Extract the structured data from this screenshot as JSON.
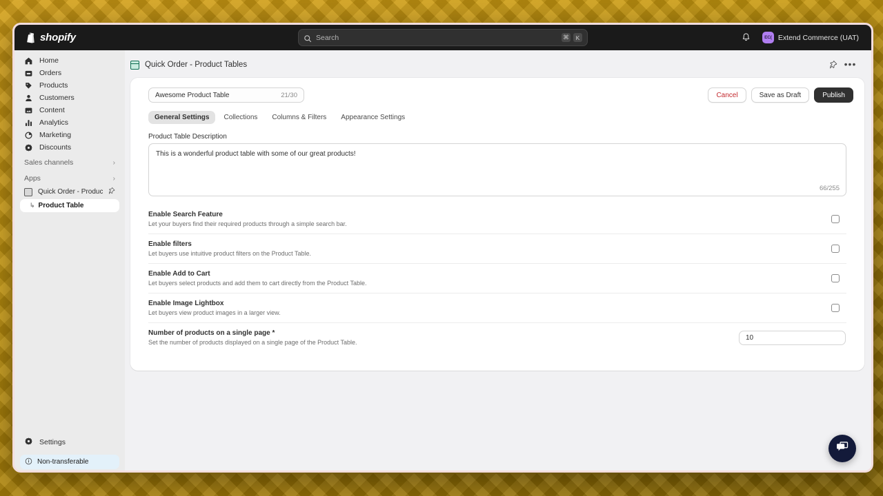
{
  "topbar": {
    "brand": "shopify",
    "brand_icon": "shopify-bag-icon",
    "search": {
      "placeholder": "Search",
      "icon": "search-icon",
      "shortcut_modifier": "⌘",
      "shortcut_key": "K"
    },
    "notifications_icon": "bell-icon",
    "store": {
      "initials": "EC(",
      "name": "Extend Commerce (UAT)",
      "avatar_color": "#b07ef0"
    }
  },
  "sidebar": {
    "items": [
      {
        "label": "Home",
        "icon": "home-icon"
      },
      {
        "label": "Orders",
        "icon": "orders-inbox-icon"
      },
      {
        "label": "Products",
        "icon": "products-tag-icon"
      },
      {
        "label": "Customers",
        "icon": "customers-person-icon"
      },
      {
        "label": "Content",
        "icon": "content-media-icon"
      },
      {
        "label": "Analytics",
        "icon": "analytics-bars-icon"
      },
      {
        "label": "Marketing",
        "icon": "marketing-megaphone-icon"
      },
      {
        "label": "Discounts",
        "icon": "discounts-gear-icon"
      }
    ],
    "groups": [
      {
        "label": "Sales channels",
        "chevron": "›"
      },
      {
        "label": "Apps",
        "chevron": "›"
      }
    ],
    "app": {
      "label": "Quick Order - Product...",
      "icon": "app-table-icon",
      "pin_icon": "pin-icon",
      "sub_item": "Product Table",
      "sub_arrow": "↳"
    },
    "settings": {
      "label": "Settings",
      "icon": "gear-icon"
    },
    "banner": {
      "label": "Non-transferable",
      "icon": "info-circle-icon",
      "bg": "#e3f1fa"
    }
  },
  "page": {
    "icon": "product-table-icon",
    "title": "Quick Order - Product Tables",
    "pin_icon": "pin-icon",
    "more_icon": "more-horizontal-icon"
  },
  "card": {
    "title_input": {
      "value": "Awesome Product Table",
      "counter": "21/30"
    },
    "buttons": {
      "cancel": "Cancel",
      "save_draft": "Save as Draft",
      "publish": "Publish"
    },
    "tabs": [
      {
        "label": "General Settings",
        "active": true
      },
      {
        "label": "Collections",
        "active": false
      },
      {
        "label": "Columns & Filters",
        "active": false
      },
      {
        "label": "Appearance Settings",
        "active": false
      }
    ],
    "description": {
      "label": "Product Table Description",
      "value": "This is a wonderful product table with some of our great products!",
      "counter": "66/255"
    },
    "settings_rows": [
      {
        "title": "Enable Search Feature",
        "desc": "Let your buyers find their required products through a simple search bar.",
        "control": "checkbox",
        "checked": false
      },
      {
        "title": "Enable filters",
        "desc": "Let buyers use intuitive product filters on the Product Table.",
        "control": "checkbox",
        "checked": false
      },
      {
        "title": "Enable Add to Cart",
        "desc": "Let buyers select products and add them to cart directly from the Product Table.",
        "control": "checkbox",
        "checked": false
      },
      {
        "title": "Enable Image Lightbox",
        "desc": "Let buyers view product images in a larger view.",
        "control": "checkbox",
        "checked": false
      },
      {
        "title": "Number of products on a single page *",
        "desc": "Set the number of products displayed on a single page of the Product Table.",
        "control": "number",
        "value": "10"
      }
    ]
  },
  "chat": {
    "icon": "chat-bubbles-icon",
    "color": "#131a3a"
  }
}
